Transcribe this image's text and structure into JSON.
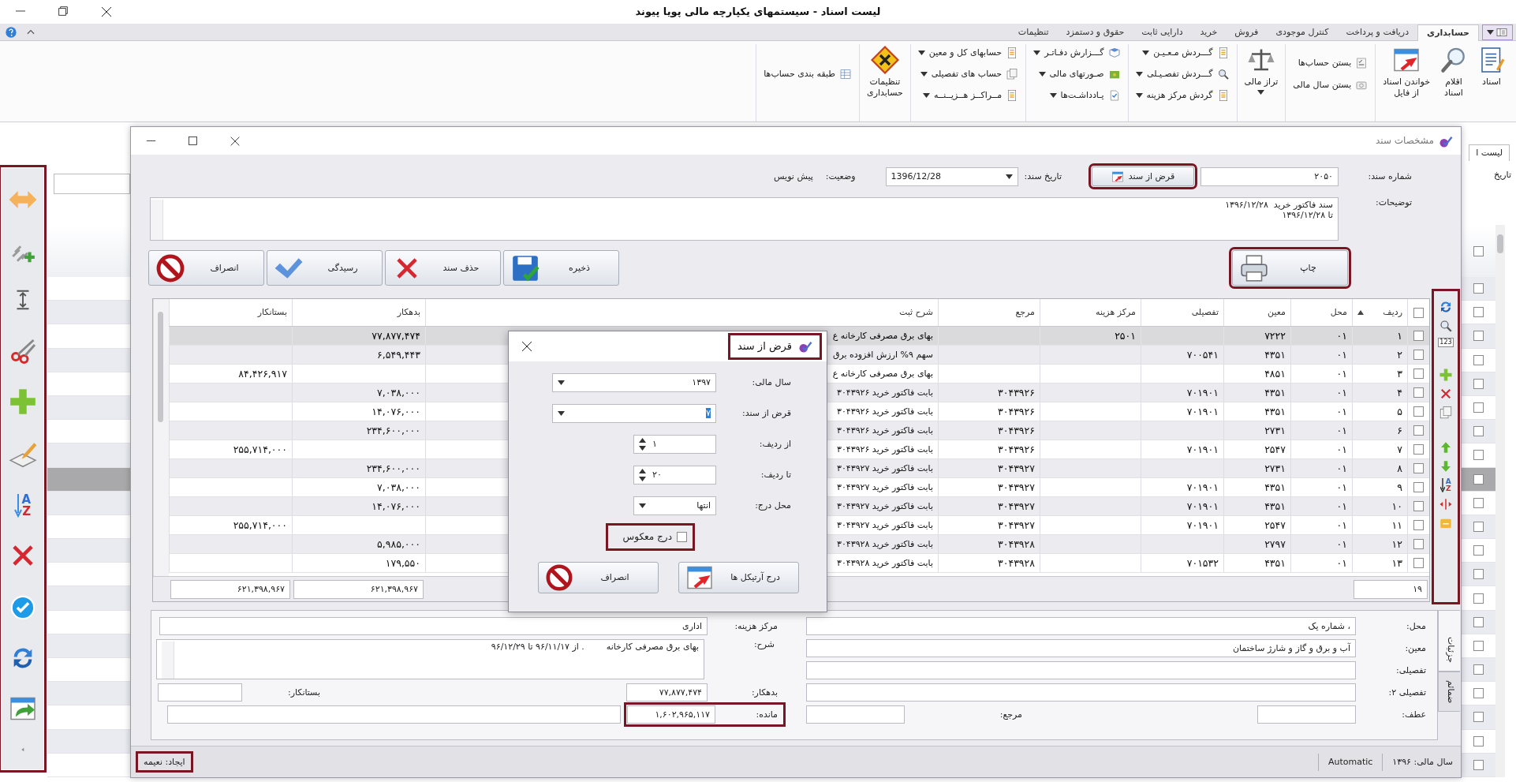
{
  "window": {
    "title": "لیست اسناد - سیستمهای یکپارچه مالی پویا پیوند"
  },
  "ribbon": {
    "tabs": [
      {
        "label": "حسابداری",
        "selected": true
      },
      {
        "label": "دریافت و پرداخت",
        "selected": false
      },
      {
        "label": "کنترل موجودی",
        "selected": false
      },
      {
        "label": "فروش",
        "selected": false
      },
      {
        "label": "خرید",
        "selected": false
      },
      {
        "label": "دارایی ثابت",
        "selected": false
      },
      {
        "label": "حقوق و دستمزد",
        "selected": false
      },
      {
        "label": "تنظیمات",
        "selected": false
      }
    ],
    "groups": [
      {
        "items": [
          {
            "kind": "large",
            "lines": [
              "اسناد"
            ]
          },
          {
            "kind": "large",
            "lines": [
              "اقلام",
              "اسناد"
            ]
          },
          {
            "kind": "large",
            "lines": [
              "خواندن اسناد",
              "از فایل"
            ]
          }
        ]
      },
      {
        "items": [
          {
            "kind": "small",
            "label": "بستن حساب‌ها"
          },
          {
            "kind": "small",
            "label": "بستن سال مالی"
          }
        ]
      },
      {
        "items": [
          {
            "kind": "large-menu",
            "lines": [
              "تراز مالی"
            ]
          }
        ]
      },
      {
        "items": [
          {
            "kind": "menu",
            "label": "گـــردش مـعـیـن"
          },
          {
            "kind": "menu",
            "label": "گـــردش تفصـیـلی"
          },
          {
            "kind": "menu",
            "label": "گردش مرکز هزینه"
          }
        ]
      },
      {
        "items": [
          {
            "kind": "menu",
            "label": "گـــزارش دفـاتـر"
          },
          {
            "kind": "menu",
            "label": "صـورتهای مالی"
          },
          {
            "kind": "menu",
            "label": "یـادداشـت‌ها"
          }
        ]
      },
      {
        "items": [
          {
            "kind": "menu",
            "label": "حسابهای کل و معین"
          },
          {
            "kind": "menu",
            "label": "حساب های تفصیلی"
          },
          {
            "kind": "menu",
            "label": "مــراکــز هــزیــنــه"
          }
        ]
      },
      {
        "items": [
          {
            "kind": "large",
            "lines": [
              "تنظیمات",
              "حسابداری"
            ]
          }
        ]
      },
      {
        "items": [
          {
            "kind": "small",
            "label": "طبقه بندی حساب‌ها"
          }
        ]
      }
    ]
  },
  "left_toolbar": {
    "highlighted": true,
    "sort_letters": "AZ"
  },
  "background_list": {
    "tab": "لیست ا",
    "filter_label": "تاریخ",
    "header_checked": false,
    "rows": [
      {
        "checked": false,
        "selected": false
      },
      {
        "checked": false,
        "selected": false
      },
      {
        "checked": false,
        "selected": false
      },
      {
        "checked": false,
        "selected": false
      },
      {
        "checked": false,
        "selected": false
      },
      {
        "checked": false,
        "selected": false
      },
      {
        "checked": false,
        "selected": false
      },
      {
        "checked": false,
        "selected": false
      },
      {
        "checked": false,
        "selected": true
      },
      {
        "checked": false,
        "selected": false
      },
      {
        "checked": false,
        "selected": false
      },
      {
        "checked": false,
        "selected": false
      },
      {
        "checked": false,
        "selected": false
      },
      {
        "checked": false,
        "selected": false
      },
      {
        "checked": false,
        "selected": false
      },
      {
        "checked": false,
        "selected": false
      },
      {
        "checked": false,
        "selected": false
      },
      {
        "checked": false,
        "selected": false
      },
      {
        "checked": false,
        "selected": false
      },
      {
        "checked": false,
        "selected": false
      },
      {
        "checked": false,
        "selected": false
      }
    ]
  },
  "document": {
    "title": "مشخصات سند",
    "number_label": "شماره سند:",
    "number": "۲۰۵۰",
    "borrow_button": {
      "label": "قرض از سند",
      "highlighted": true
    },
    "date_label": "تاریخ سند:",
    "date": "1396/12/28",
    "status_label": "وضعیت:",
    "status": "پیش نویس",
    "notes_label": "توضیحات:",
    "notes_lines": [
      "سند فاکتور خرید  ۱۳۹۶/۱۲/۲۸",
      "تا ۱۳۹۶/۱۲/۲۸"
    ]
  },
  "actions": [
    {
      "label": "ذخیره"
    },
    {
      "label": "حذف سند"
    },
    {
      "label": "رسیدگی"
    },
    {
      "label": "انصراف"
    }
  ],
  "print_button": {
    "label": "چاپ",
    "highlighted": true
  },
  "side_toolbar": {
    "highlighted": true,
    "number_label": "123",
    "sort_letters": "AZ"
  },
  "grid": {
    "header_checked": false,
    "columns": [
      {
        "label": "ردیف",
        "sorted": true
      },
      {
        "label": "محل",
        "sorted": false
      },
      {
        "label": "معین",
        "sorted": false
      },
      {
        "label": "تفصیلی",
        "sorted": false
      },
      {
        "label": "مرکز هزینه",
        "sorted": false
      },
      {
        "label": "مرجع",
        "sorted": false
      },
      {
        "label": "شرح ثبت",
        "sorted": false
      },
      {
        "label": "بدهکار",
        "sorted": false
      },
      {
        "label": "بستانکار",
        "sorted": false
      }
    ],
    "rows": [
      {
        "checked": false,
        "selected": true,
        "radif": "۱",
        "mahal": "۰۱",
        "moin": "۷۲۲۲",
        "markaz": "۲۵۰۱",
        "sharh": "بهای برق مصرفی کارخانه ع",
        "bed": "۷۷,۸۷۷,۴۷۴"
      },
      {
        "checked": false,
        "selected": false,
        "radif": "۲",
        "mahal": "۰۱",
        "moin": "۴۳۵۱",
        "tafsili": "۷۰۰۵۴۱",
        "sharh": "سهم ۹% ارزش افزوده برق",
        "bed": "۶,۵۴۹,۴۴۳"
      },
      {
        "checked": false,
        "selected": false,
        "radif": "۳",
        "mahal": "۰۱",
        "moin": "۴۸۵۱",
        "sharh": "بهای برق مصرفی کارخانه ع",
        "bes": "۸۴,۴۲۶,۹۱۷"
      },
      {
        "checked": false,
        "selected": false,
        "radif": "۴",
        "mahal": "۰۱",
        "moin": "۴۳۵۱",
        "tafsili": "۷۰۱۹۰۱",
        "marja": "۳۰۴۳۹۲۶",
        "sharh": "بابت فاکتور خرید ۳۰۴۳۹۲۶",
        "bed": "۷,۰۳۸,۰۰۰"
      },
      {
        "checked": false,
        "selected": false,
        "radif": "۵",
        "mahal": "۰۱",
        "moin": "۴۳۵۱",
        "tafsili": "۷۰۱۹۰۱",
        "marja": "۳۰۴۳۹۲۶",
        "sharh": "بابت فاکتور خرید ۳۰۴۳۹۲۶",
        "bed": "۱۴,۰۷۶,۰۰۰"
      },
      {
        "checked": false,
        "selected": false,
        "radif": "۶",
        "mahal": "۰۱",
        "moin": "۲۷۳۱",
        "marja": "۳۰۴۳۹۲۶",
        "sharh": "بابت فاکتور خرید ۳۰۴۳۹۲۶",
        "bed": "۲۳۴,۶۰۰,۰۰۰"
      },
      {
        "checked": false,
        "selected": false,
        "radif": "۷",
        "mahal": "۰۱",
        "moin": "۲۵۴۷",
        "tafsili": "۷۰۱۹۰۱",
        "marja": "۳۰۴۳۹۲۶",
        "sharh": "بابت فاکتور خرید ۳۰۴۳۹۲۶",
        "bes": "۲۵۵,۷۱۴,۰۰۰"
      },
      {
        "checked": false,
        "selected": false,
        "radif": "۸",
        "mahal": "۰۱",
        "moin": "۲۷۳۱",
        "marja": "۳۰۴۳۹۲۷",
        "sharh": "بابت فاکتور خرید ۳۰۴۳۹۲۷",
        "bed": "۲۳۴,۶۰۰,۰۰۰"
      },
      {
        "checked": false,
        "selected": false,
        "radif": "۹",
        "mahal": "۰۱",
        "moin": "۴۳۵۱",
        "tafsili": "۷۰۱۹۰۱",
        "marja": "۳۰۴۳۹۲۷",
        "sharh": "بابت فاکتور خرید ۳۰۴۳۹۲۷",
        "bed": "۷,۰۳۸,۰۰۰"
      },
      {
        "checked": false,
        "selected": false,
        "radif": "۱۰",
        "mahal": "۰۱",
        "moin": "۴۳۵۱",
        "tafsili": "۷۰۱۹۰۱",
        "marja": "۳۰۴۳۹۲۷",
        "sharh": "بابت فاکتور خرید ۳۰۴۳۹۲۷",
        "bed": "۱۴,۰۷۶,۰۰۰"
      },
      {
        "checked": false,
        "selected": false,
        "radif": "۱۱",
        "mahal": "۰۱",
        "moin": "۲۵۴۷",
        "tafsili": "۷۰۱۹۰۱",
        "marja": "۳۰۴۳۹۲۷",
        "sharh": "بابت فاکتور خرید ۳۰۴۳۹۲۷",
        "bes": "۲۵۵,۷۱۴,۰۰۰"
      },
      {
        "checked": false,
        "selected": false,
        "radif": "۱۲",
        "mahal": "۰۱",
        "moin": "۲۷۹۷",
        "marja": "۳۰۴۳۹۲۸",
        "sharh": "بابت فاکتور خرید ۳۰۴۳۹۲۸",
        "bed": "۵,۹۸۵,۰۰۰"
      },
      {
        "checked": false,
        "selected": false,
        "radif": "۱۳",
        "mahal": "۰۱",
        "moin": "۴۳۵۱",
        "tafsili": "۷۰۱۵۳۲",
        "marja": "۳۰۴۳۹۲۸",
        "sharh": "بابت فاکتور خرید ۳۰۴۳۹۲۸",
        "bed": "۱۷۹,۵۵۰"
      }
    ],
    "footer": {
      "count": "۱۹",
      "debit_total": "۶۲۱,۳۹۸,۹۶۷",
      "credit_total": "۶۲۱,۳۹۸,۹۶۷"
    }
  },
  "dialog": {
    "title": "قرض از سند",
    "title_highlighted": true,
    "fields": [
      {
        "kind": "select",
        "label": "سال مالی:",
        "value": "۱۳۹۷"
      },
      {
        "kind": "select",
        "label": "قرض از سند:",
        "value": "۷",
        "text_selected": true
      },
      {
        "kind": "spin",
        "label": "از ردیف:",
        "value": "۱"
      },
      {
        "kind": "spin",
        "label": "تا ردیف:",
        "value": "۲۰"
      },
      {
        "kind": "dropdown",
        "label": "محل درج:",
        "value": "انتها"
      }
    ],
    "reverse": {
      "label": "درج معکوس",
      "checked": false,
      "highlighted": true
    },
    "buttons": [
      {
        "label": "درج آرتیکل ها"
      },
      {
        "label": "انصراف"
      }
    ]
  },
  "details": {
    "tabs": [
      {
        "label": "جزئیات",
        "selected": true
      },
      {
        "label": "ضمائم",
        "selected": false
      }
    ],
    "location_label": "محل:",
    "location": "، شماره یک",
    "account_label": "معین:",
    "account": "آب و برق و گاز و شارژ ساختمان",
    "detail_label": "تفصیلی:",
    "detail2_label": "تفصیلی ۲:",
    "ref_label": "عطف:",
    "reference_label": "مرجع:",
    "cost_center_label": "مرکز هزینه:",
    "cost_center": "اداری",
    "description_label": "شرح:",
    "description": "بهای برق مصرفی کارخانه        . از ۹۶/۱۱/۱۷ تا ۹۶/۱۲/۲۹",
    "debit_label": "بدهکار:",
    "debit": "۷۷,۸۷۷,۴۷۴",
    "credit_label": "بستانکار:",
    "balance_label": "مانده:",
    "balance": "۱,۶۰۲,۹۶۵,۱۱۷",
    "balance_highlighted": true
  },
  "status_bar": {
    "fiscal_year": "سال مالی: ۱۳۹۶",
    "mode": "Automatic",
    "creator": "ایجاد: نعیمه",
    "creator_highlighted": true
  }
}
